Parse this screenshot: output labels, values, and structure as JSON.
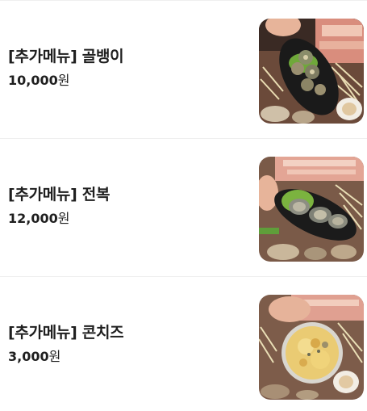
{
  "menu": {
    "items": [
      {
        "name": "[추가메뉴] 골뱅이",
        "price": "10,000",
        "currency": "원",
        "image": "sea-snail-platter-photo"
      },
      {
        "name": "[추가메뉴] 전복",
        "price": "12,000",
        "currency": "원",
        "image": "abalone-platter-photo"
      },
      {
        "name": "[추가메뉴] 콘치즈",
        "price": "3,000",
        "currency": "원",
        "image": "corn-cheese-photo"
      }
    ]
  }
}
